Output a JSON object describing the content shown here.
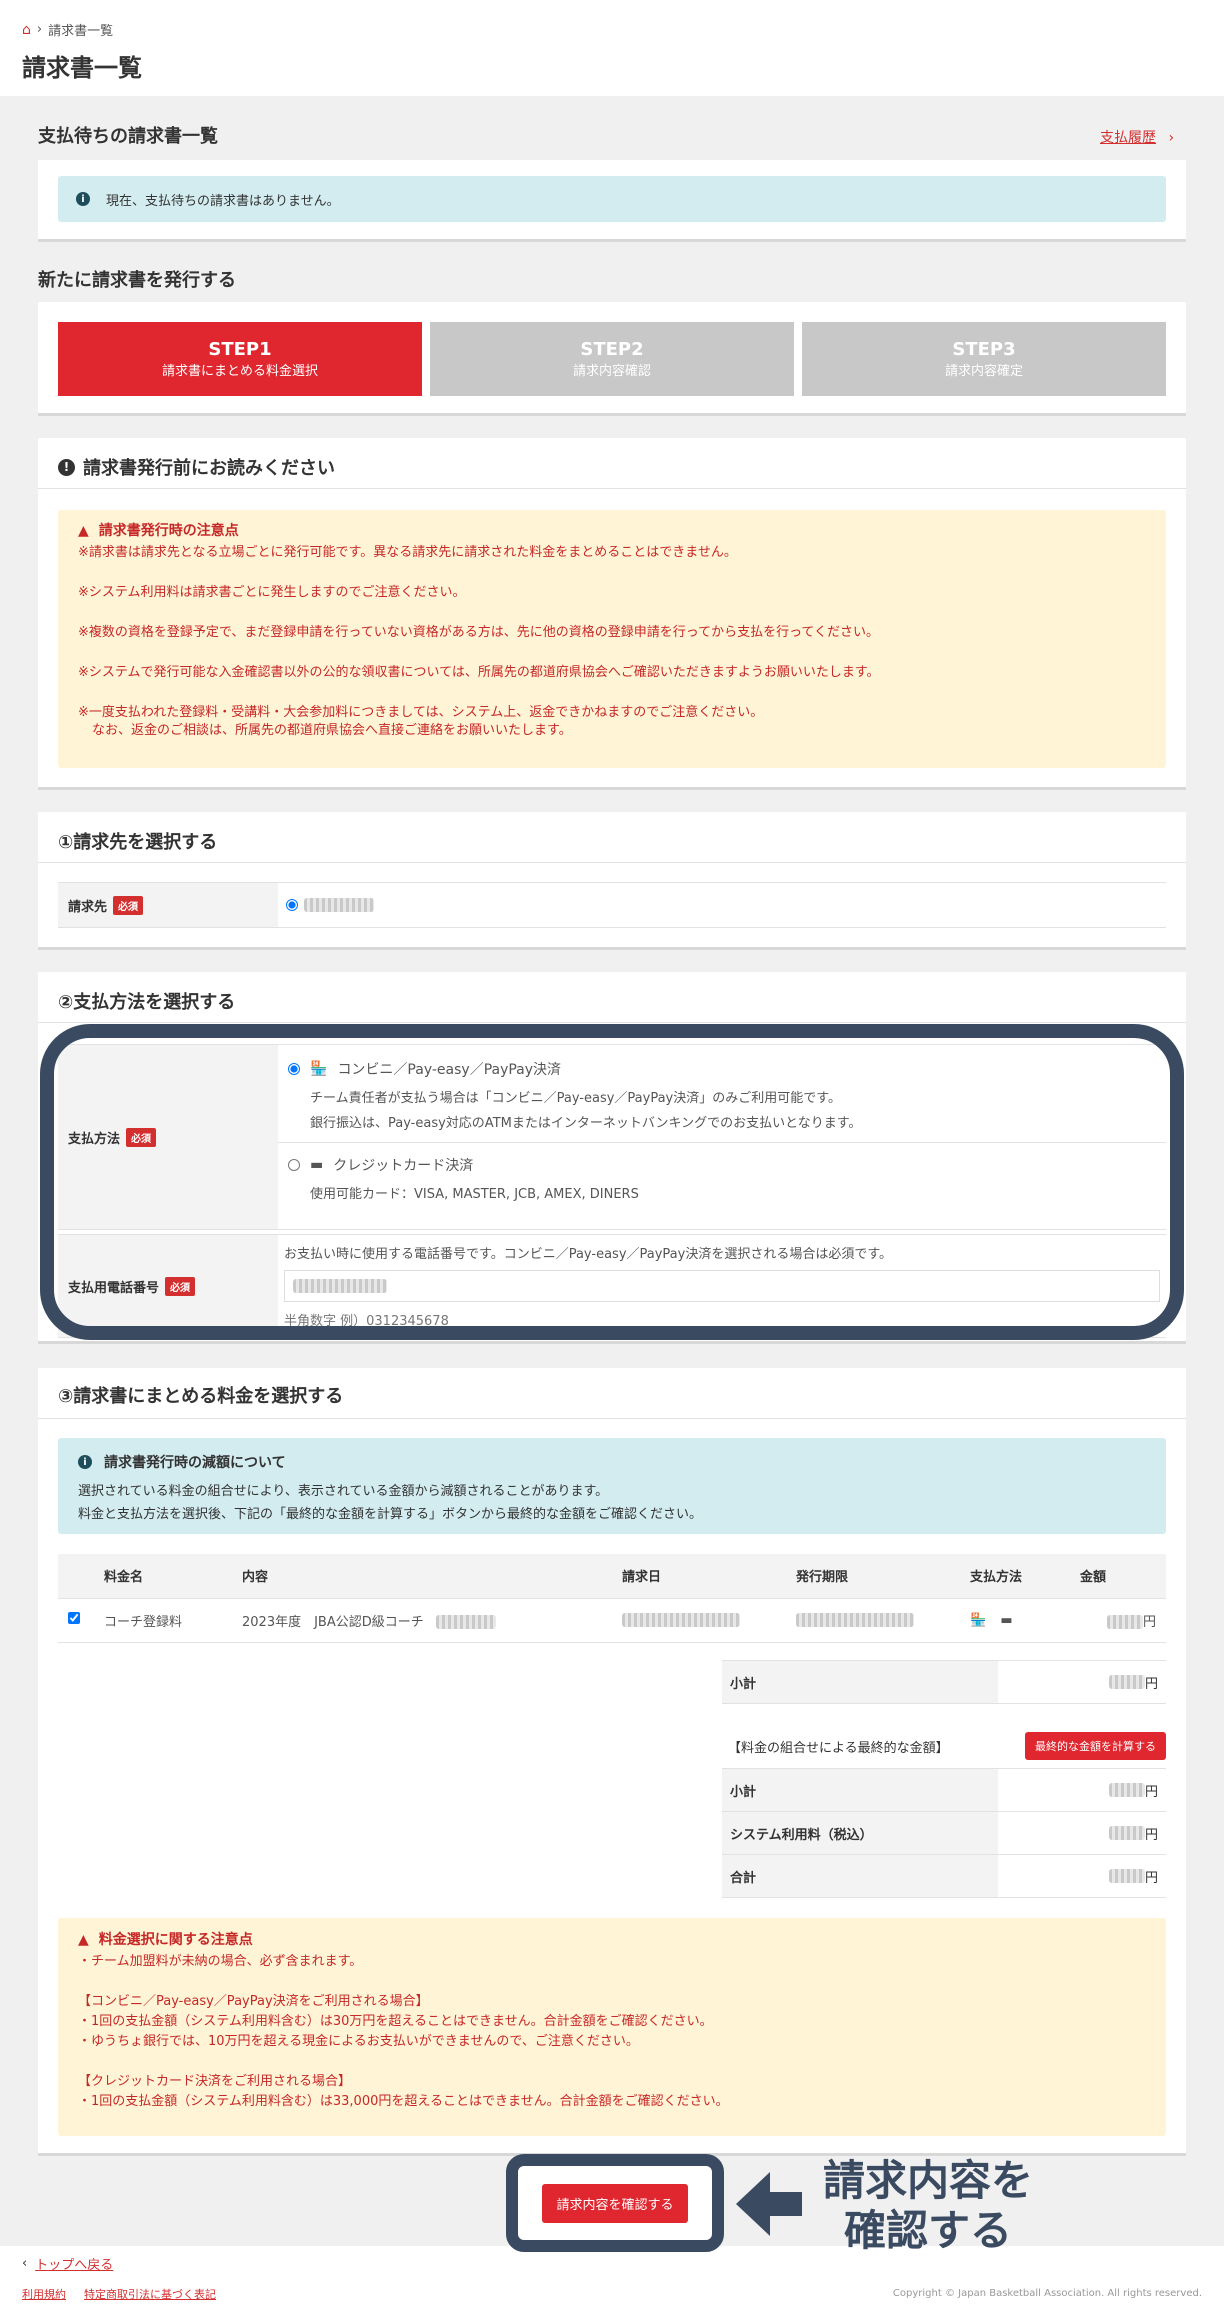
{
  "breadcrumb": {
    "current": "請求書一覧"
  },
  "page_title": "請求書一覧",
  "pending": {
    "title": "支払待ちの請求書一覧",
    "history_link": "支払履歴",
    "info": "現在、支払待ちの請求書はありません。"
  },
  "issue_title": "新たに請求書を発行する",
  "steps": [
    {
      "title": "STEP1",
      "sub": "請求書にまとめる料金選択"
    },
    {
      "title": "STEP2",
      "sub": "請求内容確認"
    },
    {
      "title": "STEP3",
      "sub": "請求内容確定"
    }
  ],
  "notice": {
    "title": "請求書発行前にお読みください",
    "box_title": "請求書発行時の注意点",
    "lines": [
      "※請求書は請求先となる立場ごとに発行可能です。異なる請求先に請求された料金をまとめることはできません。",
      "※システム利用料は請求書ごとに発生しますのでご注意ください。",
      "※複数の資格を登録予定で、まだ登録申請を行っていない資格がある方は、先に他の資格の登録申請を行ってから支払を行ってください。",
      "※システムで発行可能な入金確認書以外の公的な領収書については、所属先の都道府県協会へご確認いただきますようお願いいたします。",
      "※一度支払われた登録料・受講料・大会参加料につきましては、システム上、返金できかねますのでご注意ください。",
      "なお、返金のご相談は、所属先の都道府県協会へ直接ご連絡をお願いいたします。"
    ]
  },
  "section1": {
    "title": "①請求先を選択する",
    "label": "請求先",
    "required": "必須"
  },
  "section2": {
    "title": "②支払方法を選択する",
    "method_label": "支払方法",
    "required": "必須",
    "option1_title": "コンビニ／Pay-easy／PayPay決済",
    "option1_desc1": "チーム責任者が支払う場合は「コンビニ／Pay-easy／PayPay決済」のみご利用可能です。",
    "option1_desc2": "銀行振込は、Pay-easy対応のATMまたはインターネットバンキングでのお支払いとなります。",
    "option2_title": "クレジットカード決済",
    "option2_desc": "使用可能カード：VISA, MASTER, JCB, AMEX, DINERS",
    "phone_label": "支払用電話番号",
    "phone_note": "お支払い時に使用する電話番号です。コンビニ／Pay-easy／PayPay決済を選択される場合は必須です。",
    "phone_hint": "半角数字 例）0312345678"
  },
  "section3": {
    "title": "③請求書にまとめる料金を選択する",
    "info_title": "請求書発行時の減額について",
    "info_line1": "選択されている料金の組合せにより、表示されている金額から減額されることがあります。",
    "info_line2": "料金と支払方法を選択後、下記の「最終的な金額を計算する」ボタンから最終的な金額をご確認ください。",
    "columns": [
      "料金名",
      "内容",
      "請求日",
      "発行期限",
      "支払方法",
      "金額"
    ],
    "row": {
      "name": "コーチ登録料",
      "content": "2023年度　JBA公認D級コーチ",
      "yen": "円"
    },
    "subtotal_label": "小計",
    "yen": "円",
    "final_label": "【料金の組合せによる最終的な金額】",
    "calc_button": "最終的な金額を計算する",
    "final_rows": [
      "小計",
      "システム利用料（税込）",
      "合計"
    ],
    "warn_title": "料金選択に関する注意点",
    "warn_lines": [
      "・チーム加盟料が未納の場合、必ず含まれます。",
      "",
      "【コンビニ／Pay-easy／PayPay決済をご利用される場合】",
      "・1回の支払金額（システム利用料含む）は30万円を超えることはできません。合計金額をご確認ください。",
      "・ゆうちょ銀行では、10万円を超える現金によるお支払いができませんので、ご注意ください。",
      "",
      "【クレジットカード決済をご利用される場合】",
      "・1回の支払金額（システム利用料含む）は33,000円を超えることはできません。合計金額をご確認ください。"
    ]
  },
  "confirm_button": "請求内容を確認する",
  "annotation": {
    "line1": "請求内容を",
    "line2": "確認する"
  },
  "footer": {
    "back_top": "トップへ戻る",
    "terms": "利用規約",
    "tokushoho": "特定商取引法に基づく表記",
    "copyright": "Copyright © Japan Basketball Association. All rights reserved."
  },
  "colors": {
    "accent": "#e0262f",
    "navy": "#3a4a61",
    "info": "#d3ecf0",
    "warn": "#fff5d6"
  }
}
